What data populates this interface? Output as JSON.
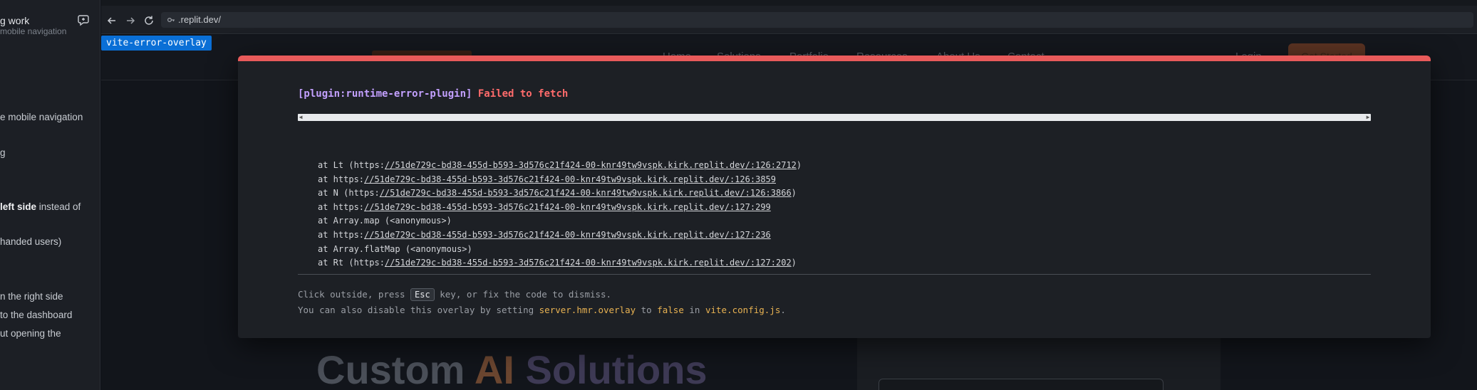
{
  "left_panel": {
    "title": "g work",
    "lines": [
      {
        "text": "mobile navigation",
        "faded": true
      },
      {
        "text": "e mobile navigation"
      },
      {
        "text": "g"
      },
      {
        "bold": "left side",
        "text": " instead of"
      },
      {
        "text": "handed users)"
      },
      {
        "text": "n the right side"
      },
      {
        "text": "to the dashboard"
      },
      {
        "text": "ut opening the"
      }
    ]
  },
  "browser": {
    "url": ".replit.dev/"
  },
  "site": {
    "nav_links": [
      "Home",
      "Solutions",
      "Portfolio",
      "Resources",
      "About Us",
      "Contact"
    ],
    "login": "Login",
    "cta": "Get Started",
    "hero": {
      "part1": "Custom ",
      "part2": "AI ",
      "part3": "Solutions"
    }
  },
  "vite_badge": "vite-error-overlay",
  "overlay": {
    "plugin": "[plugin:runtime-error-plugin]",
    "message": "Failed to fetch",
    "stack": [
      {
        "prefix": "at Lt (https:",
        "url": "//51de729c-bd38-455d-b593-3d576c21f424-00-knr49tw9vspk.kirk.replit.dev/:126:2712",
        "suffix": ")"
      },
      {
        "prefix": "at https:",
        "url": "//51de729c-bd38-455d-b593-3d576c21f424-00-knr49tw9vspk.kirk.replit.dev/:126:3859",
        "suffix": ""
      },
      {
        "prefix": "at N (https:",
        "url": "//51de729c-bd38-455d-b593-3d576c21f424-00-knr49tw9vspk.kirk.replit.dev/:126:3866",
        "suffix": ")"
      },
      {
        "prefix": "at https:",
        "url": "//51de729c-bd38-455d-b593-3d576c21f424-00-knr49tw9vspk.kirk.replit.dev/:127:299",
        "suffix": ""
      },
      {
        "prefix": "at Array.map (<anonymous>)",
        "url": "",
        "suffix": ""
      },
      {
        "prefix": "at https:",
        "url": "//51de729c-bd38-455d-b593-3d576c21f424-00-knr49tw9vspk.kirk.replit.dev/:127:236",
        "suffix": ""
      },
      {
        "prefix": "at Array.flatMap (<anonymous>)",
        "url": "",
        "suffix": ""
      },
      {
        "prefix": "at Rt (https:",
        "url": "//51de729c-bd38-455d-b593-3d576c21f424-00-knr49tw9vspk.kirk.replit.dev/:127:202",
        "suffix": ")"
      }
    ],
    "tip1": {
      "before": "Click outside, press ",
      "key": "Esc",
      "after": " key, or fix the code to dismiss."
    },
    "tip2": {
      "before": "You can also disable this overlay by setting ",
      "code1": "server.hmr.overlay",
      "mid1": " to ",
      "code2": "false",
      "mid2": " in ",
      "code3": "vite.config.js",
      "after": "."
    }
  },
  "colors": {
    "overlay_accent": "#e85a5a",
    "plugin_purple": "#c3a0ff",
    "error_red": "#ff6b6b",
    "badge_blue": "#0a6fd6",
    "code_yellow": "#e8b252"
  }
}
